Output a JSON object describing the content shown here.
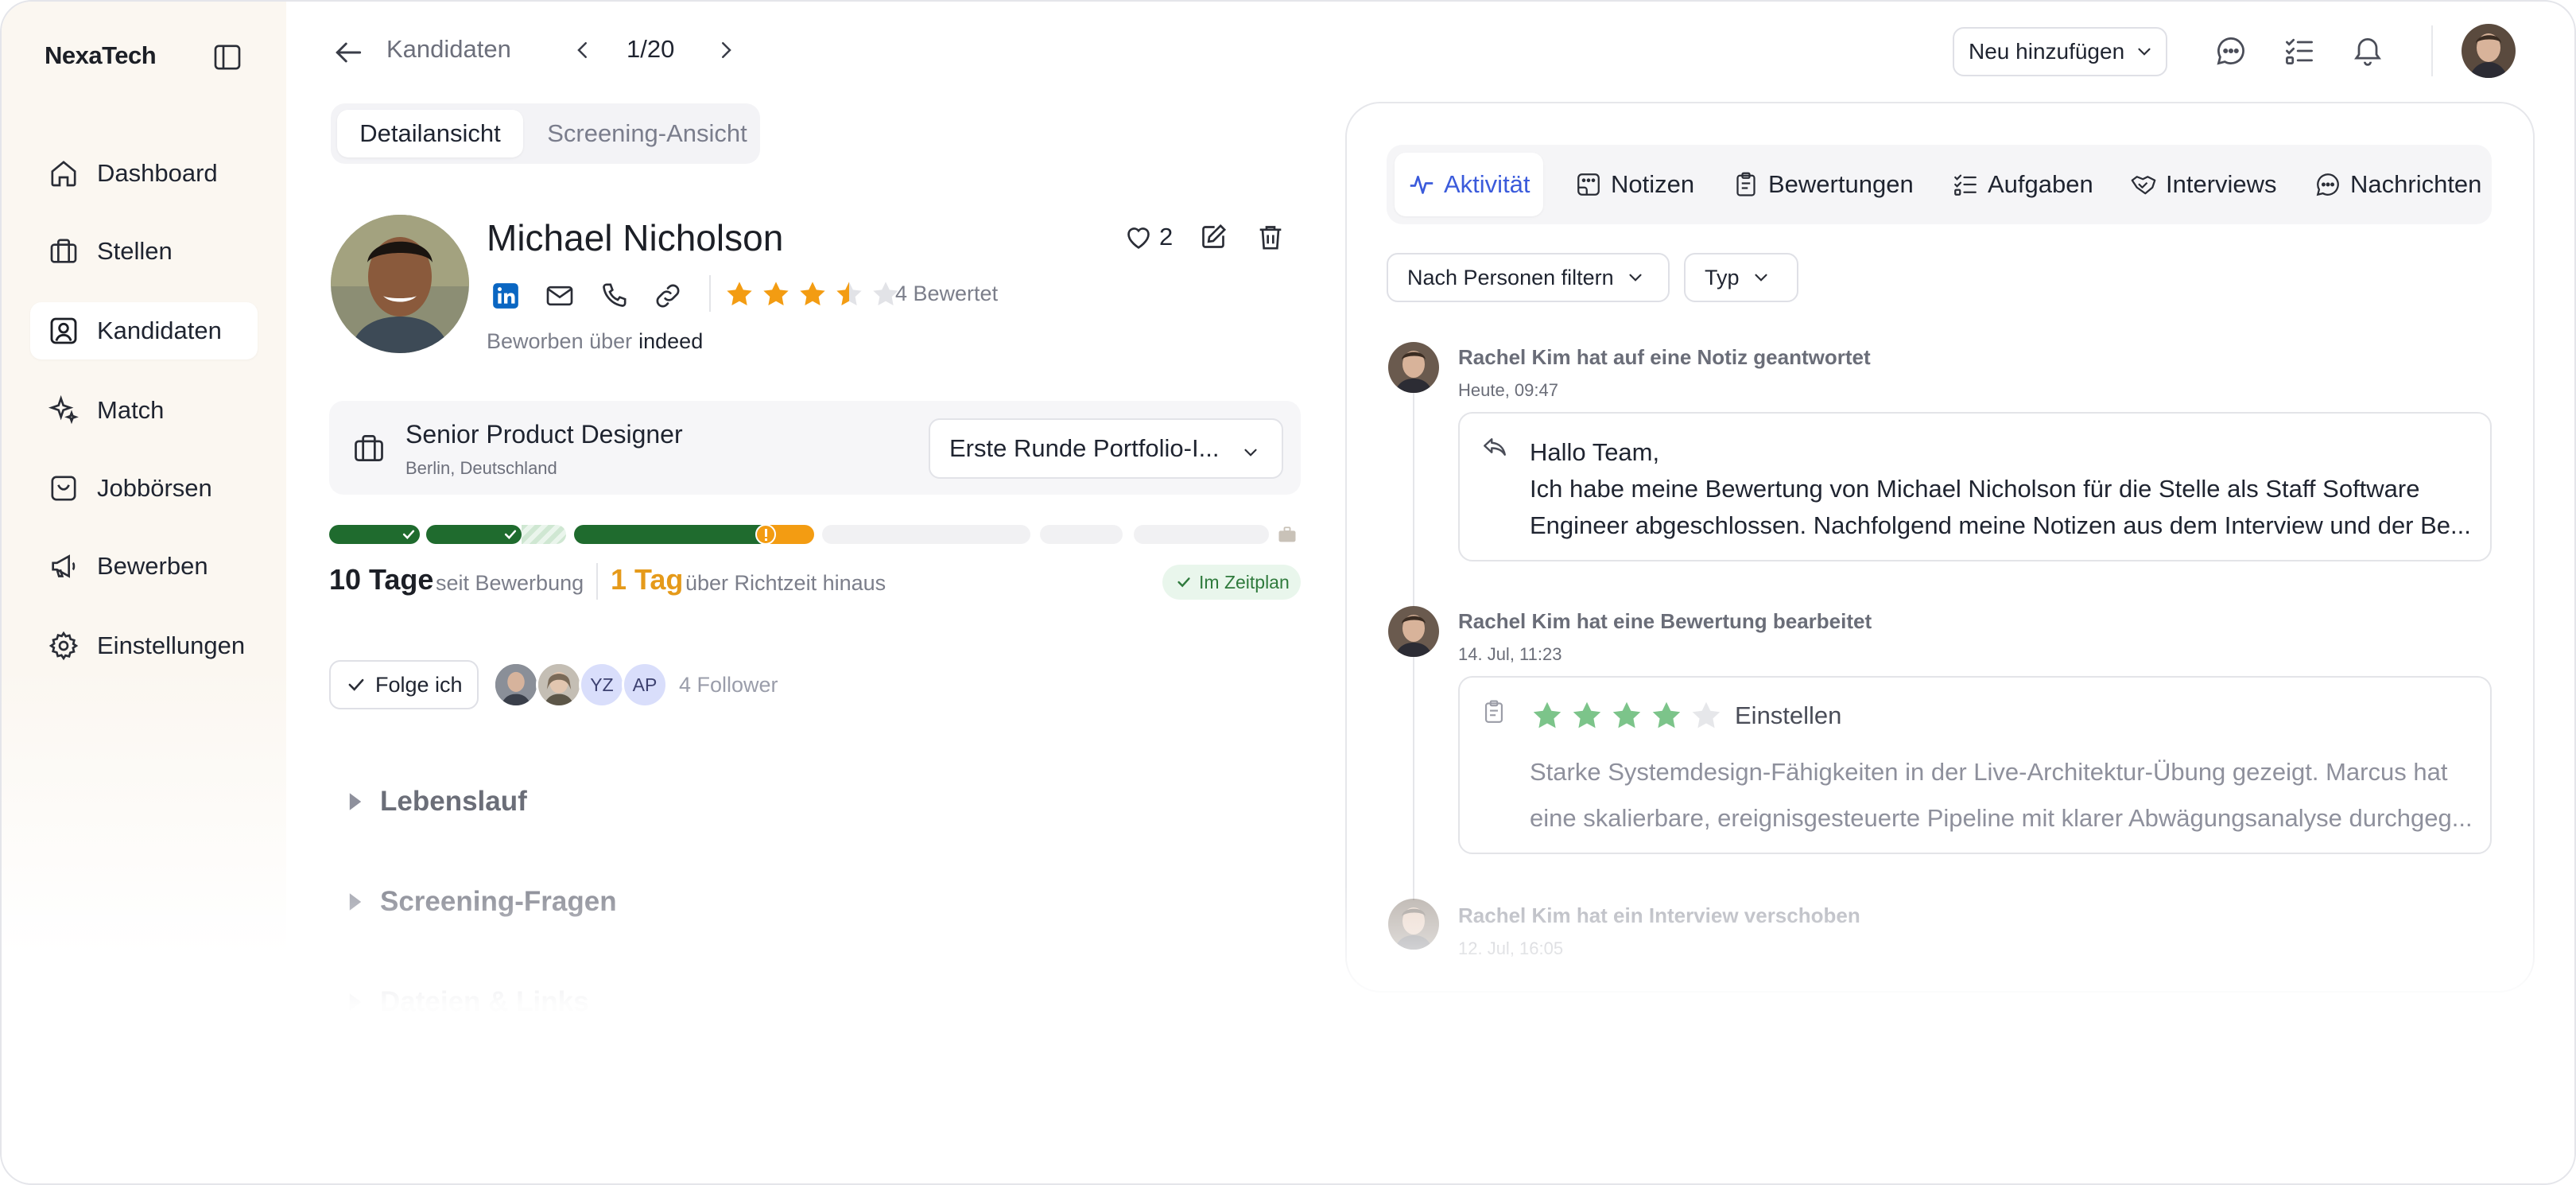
{
  "app": {
    "name": "NexaTech"
  },
  "sidebar": {
    "items": [
      {
        "label": "Dashboard",
        "icon": "home-icon"
      },
      {
        "label": "Stellen",
        "icon": "briefcase-icon"
      },
      {
        "label": "Kandidaten",
        "icon": "user-square-icon",
        "active": true
      },
      {
        "label": "Match",
        "icon": "sparkle-icon"
      },
      {
        "label": "Jobbörsen",
        "icon": "inbox-icon"
      },
      {
        "label": "Bewerben",
        "icon": "megaphone-icon"
      },
      {
        "label": "Einstellungen",
        "icon": "gear-icon"
      }
    ]
  },
  "topbar": {
    "breadcrumb": "Kandidaten",
    "pager": "1/20",
    "add_new": "Neu hinzufügen"
  },
  "view_tabs": {
    "detail": "Detailansicht",
    "screening": "Screening-Ansicht"
  },
  "candidate": {
    "name": "Michael Nicholson",
    "likes": "2",
    "rating": 3.5,
    "rating_label": "4 Bewertet",
    "applied_via_label": "Beworben über",
    "applied_via": "indeed"
  },
  "job": {
    "title": "Senior Product Designer",
    "location": "Berlin, Deutschland",
    "stage": "Erste Runde Portfolio-I..."
  },
  "timeline": {
    "days": "10 Tage",
    "days_sub": "seit Bewerbung",
    "overdue": "1 Tag",
    "overdue_sub": "über Richtzeit hinaus",
    "status": "Im Zeitplan"
  },
  "followers": {
    "follow_button": "Folge ich",
    "avatars": [
      "YZ",
      "AP"
    ],
    "count_label": "4 Follower"
  },
  "sections": [
    "Lebenslauf",
    "Screening-Fragen",
    "Dateien & Links"
  ],
  "activity_tabs": [
    {
      "label": "Aktivität",
      "icon": "activity-icon",
      "active": true
    },
    {
      "label": "Notizen",
      "icon": "notes-icon"
    },
    {
      "label": "Bewertungen",
      "icon": "clipboard-icon"
    },
    {
      "label": "Aufgaben",
      "icon": "tasks-icon"
    },
    {
      "label": "Interviews",
      "icon": "handshake-icon"
    },
    {
      "label": "Nachrichten",
      "icon": "chat-icon"
    }
  ],
  "filters": {
    "people": "Nach Personen filtern",
    "type": "Typ"
  },
  "activities": [
    {
      "head": "Rachel Kim hat auf eine Notiz geantwortet",
      "time": "Heute, 09:47",
      "lines": [
        "Hallo Team,",
        "Ich habe meine Bewertung von Michael Nicholson für die Stelle als Staff Software",
        "Engineer abgeschlossen. Nachfolgend meine Notizen aus dem Interview und der Be..."
      ]
    },
    {
      "head": "Rachel Kim hat eine Bewertung bearbeitet",
      "time": "14. Jul, 11:23",
      "rating": 4,
      "rating_label": "Einstellen",
      "lines": [
        "Starke Systemdesign-Fähigkeiten in der Live-Architektur-Übung gezeigt. Marcus hat",
        "eine skalierbare, ereignisgesteuerte Pipeline mit klarer Abwägungsanalyse durchgeg..."
      ]
    },
    {
      "head": "Rachel Kim hat ein Interview verschoben",
      "time": "12. Jul, 16:05"
    }
  ],
  "colors": {
    "accent": "#3b5bdb",
    "star": "#f39c12",
    "review_star": "#7cc48a",
    "progress_done": "#1f6b2e",
    "progress_warn": "#f39c12",
    "status_ok": "#2f7a3c",
    "linkedin": "#0a66c2"
  }
}
